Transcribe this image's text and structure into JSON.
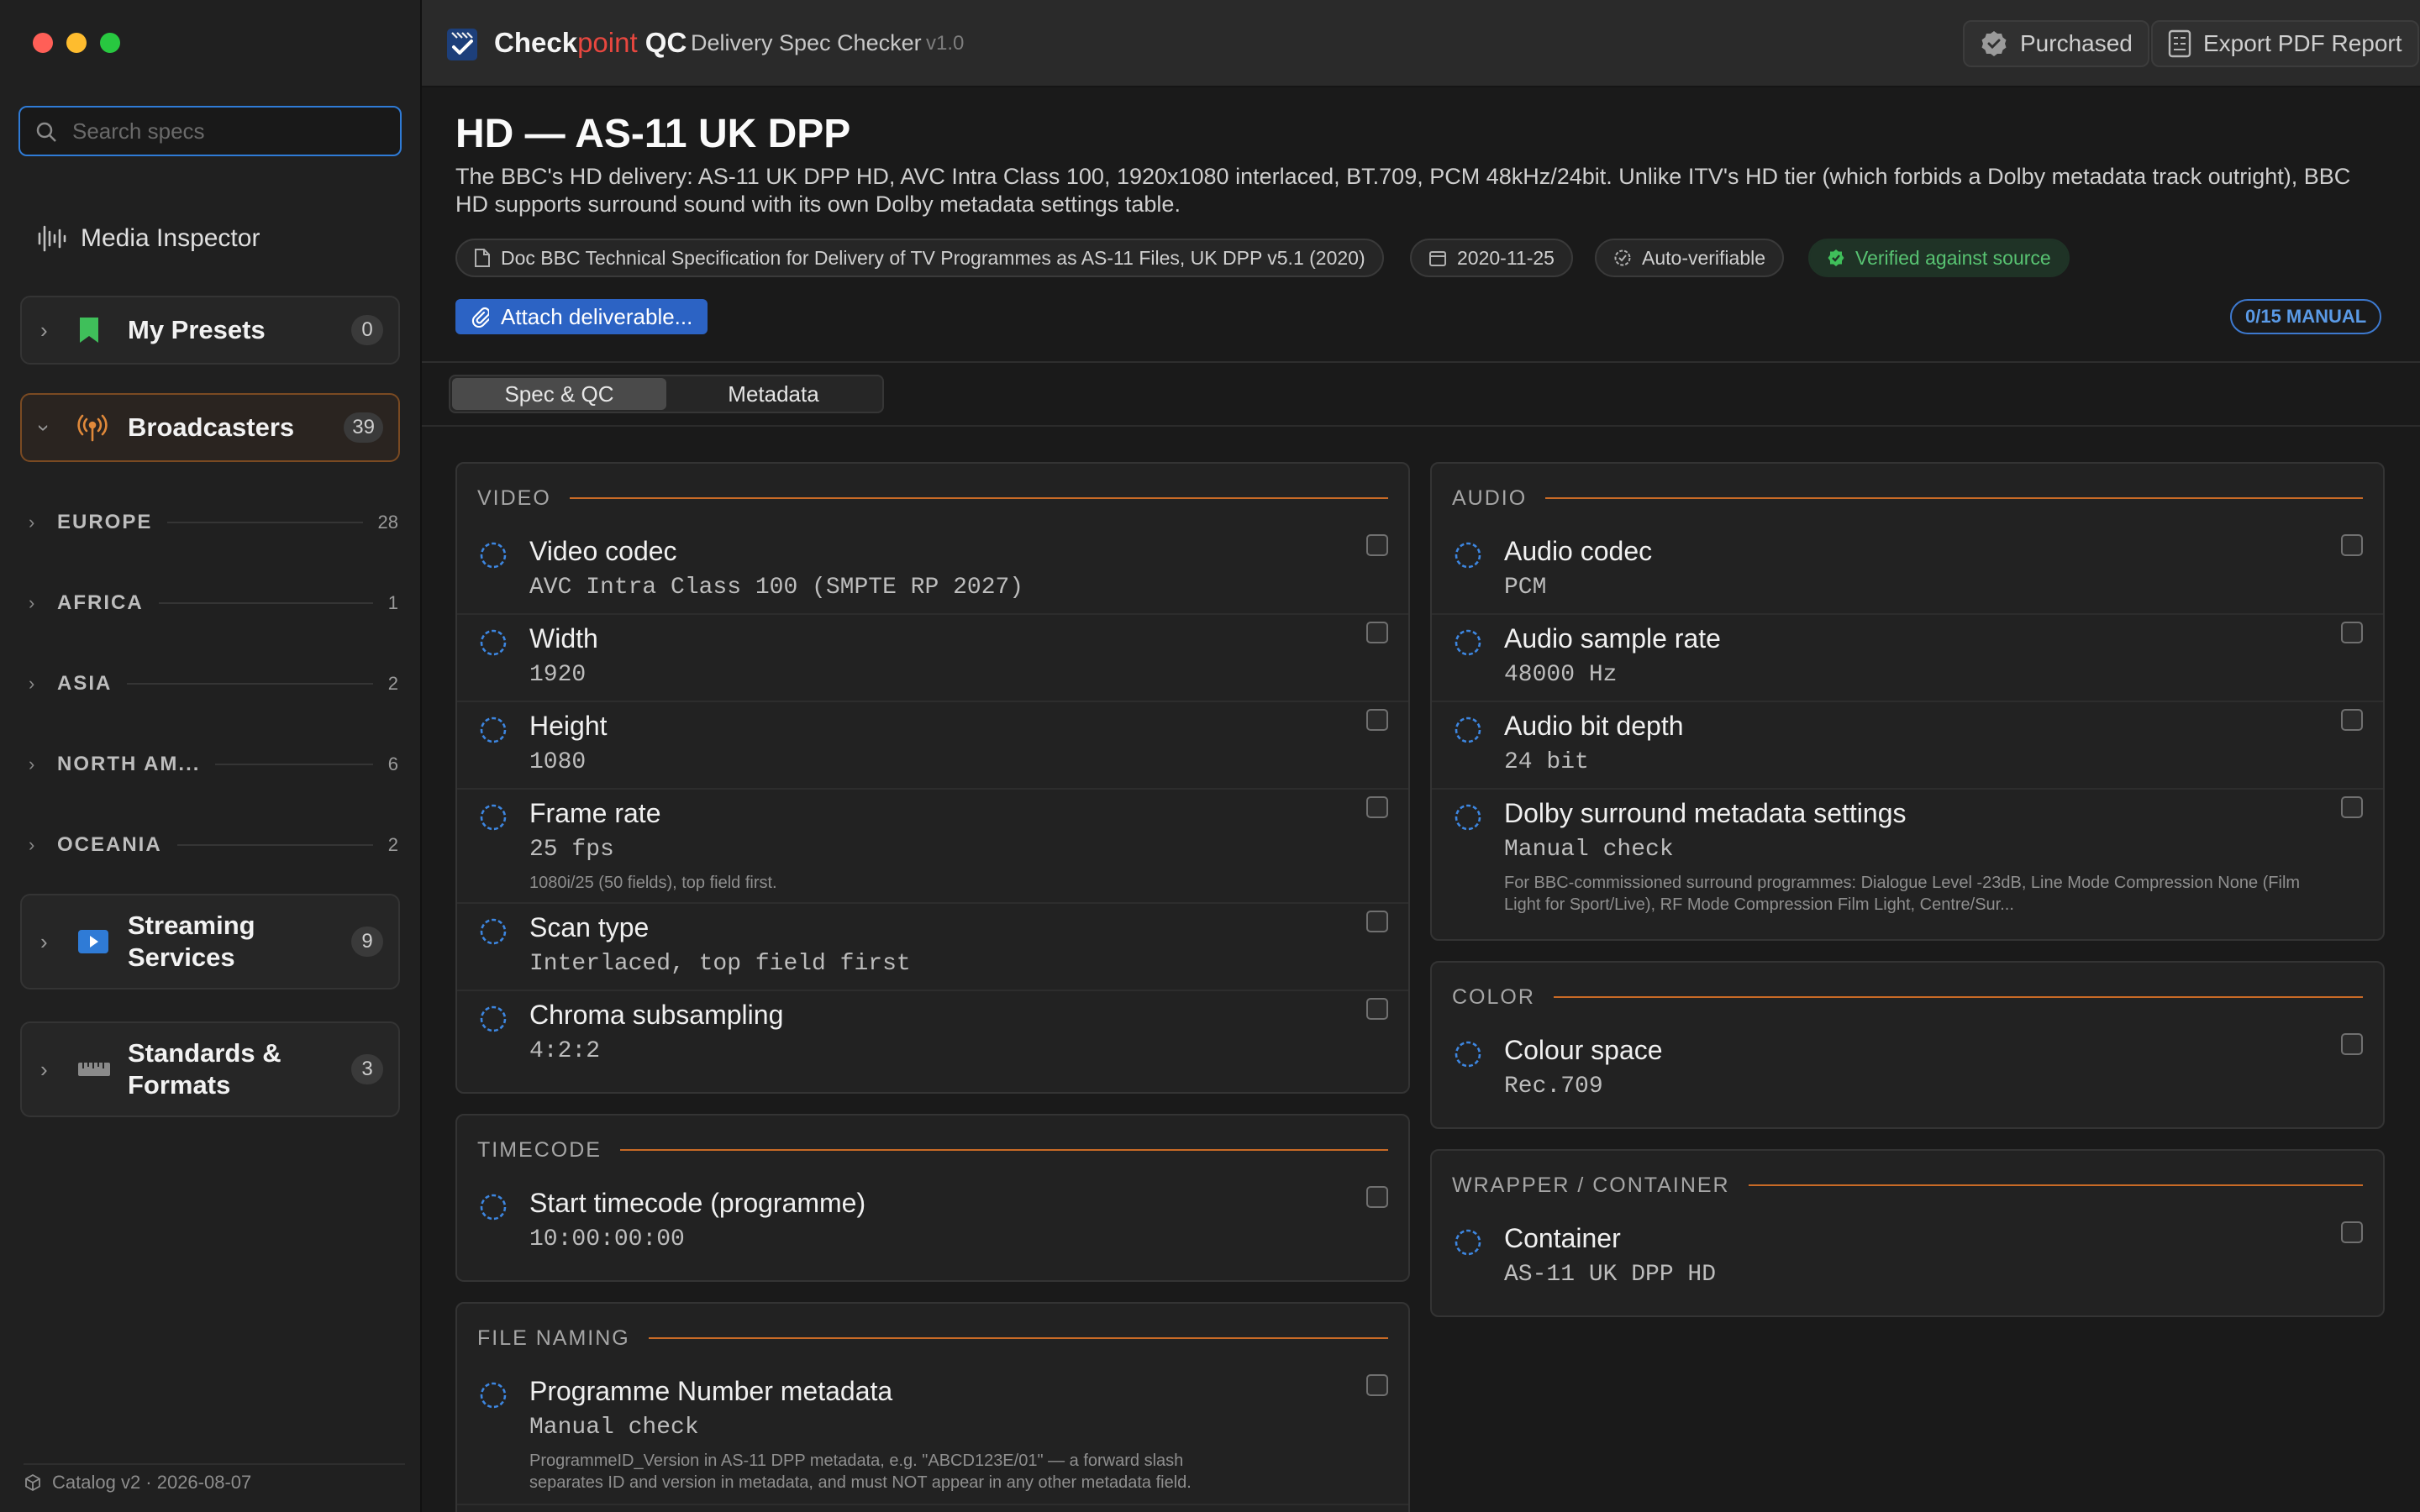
{
  "window": {
    "colors": {
      "close": "#ff5f57",
      "minimize": "#febc2e",
      "zoom": "#28c840",
      "accent": "#d9782b",
      "link": "#2f7bd6"
    }
  },
  "sidebar": {
    "search_placeholder": "Search specs",
    "media_inspector": "Media Inspector",
    "groups": [
      {
        "label": "My Presets",
        "count": "0"
      },
      {
        "label": "Broadcasters",
        "count": "39"
      },
      {
        "label": "Streaming Services",
        "count": "9"
      },
      {
        "label": "Standards & Formats",
        "count": "3"
      }
    ],
    "regions": [
      {
        "name": "EUROPE",
        "count": "28"
      },
      {
        "name": "AFRICA",
        "count": "1"
      },
      {
        "name": "ASIA",
        "count": "2"
      },
      {
        "name": "NORTH AM...",
        "count": "6"
      },
      {
        "name": "OCEANIA",
        "count": "2"
      }
    ],
    "footer": "Catalog v2 · 2026-08-07"
  },
  "topbar": {
    "brand_a": "Check",
    "brand_b": "point",
    "brand_c": " QC",
    "subtitle": "Delivery Spec Checker",
    "version": "v1.0",
    "purchased": "Purchased",
    "export": "Export PDF Report"
  },
  "header": {
    "title": "HD — AS-11 UK DPP",
    "description": "The BBC's HD delivery: AS-11 UK DPP HD, AVC Intra Class 100, 1920x1080 interlaced, BT.709, PCM 48kHz/24bit. Unlike ITV's HD tier (which forbids a Dolby metadata track outright), BBC HD supports surround sound with its own Dolby metadata settings table.",
    "chips": {
      "doc": "Doc BBC Technical Specification for Delivery of TV Programmes as AS-11 Files, UK DPP v5.1 (2020)",
      "date": "2020-11-25",
      "auto": "Auto-verifiable",
      "verified": "Verified against source"
    },
    "attach": "Attach deliverable...",
    "manual_badge": "0/15 MANUAL"
  },
  "tabs": [
    "Spec & QC",
    "Metadata"
  ],
  "sections": {
    "video": {
      "title": "VIDEO",
      "rows": [
        {
          "label": "Video codec",
          "value": "AVC Intra Class 100 (SMPTE RP 2027)"
        },
        {
          "label": "Width",
          "value": "1920"
        },
        {
          "label": "Height",
          "value": "1080"
        },
        {
          "label": "Frame rate",
          "value": "25 fps",
          "note": "1080i/25 (50 fields), top field first."
        },
        {
          "label": "Scan type",
          "value": "Interlaced, top field first"
        },
        {
          "label": "Chroma subsampling",
          "value": "4:2:2"
        }
      ]
    },
    "timecode": {
      "title": "TIMECODE",
      "rows": [
        {
          "label": "Start timecode (programme)",
          "value": "10:00:00:00"
        }
      ]
    },
    "file_naming": {
      "title": "FILE NAMING",
      "rows": [
        {
          "label": "Programme Number metadata",
          "value": "Manual check",
          "note": "ProgrammeID_Version in AS-11 DPP metadata, e.g. \"ABCD123E/01\" — a forward slash separates ID and version in metadata, and must NOT appear in any other metadata field."
        }
      ]
    },
    "audio": {
      "title": "AUDIO",
      "rows": [
        {
          "label": "Audio codec",
          "value": "PCM"
        },
        {
          "label": "Audio sample rate",
          "value": "48000 Hz"
        },
        {
          "label": "Audio bit depth",
          "value": "24 bit"
        },
        {
          "label": "Dolby surround metadata settings",
          "value": "Manual check",
          "note": "For BBC-commissioned surround programmes: Dialogue Level -23dB, Line Mode Compression None (Film Light for Sport/Live), RF Mode Compression Film Light, Centre/Sur..."
        }
      ]
    },
    "color": {
      "title": "COLOR",
      "rows": [
        {
          "label": "Colour space",
          "value": "Rec.709"
        }
      ]
    },
    "wrapper": {
      "title": "WRAPPER / CONTAINER",
      "rows": [
        {
          "label": "Container",
          "value": "AS-11 UK DPP HD"
        }
      ]
    }
  }
}
